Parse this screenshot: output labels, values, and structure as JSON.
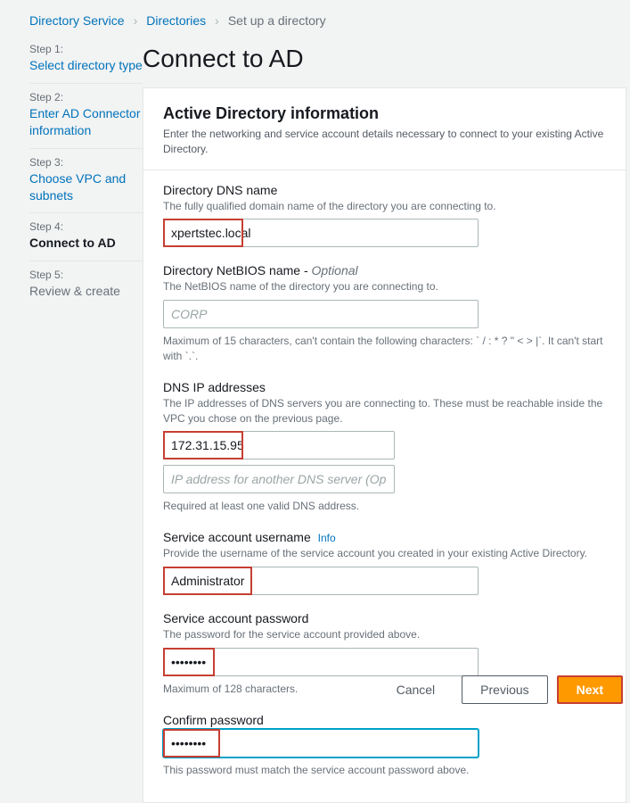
{
  "breadcrumb": {
    "root": "Directory Service",
    "section": "Directories",
    "current": "Set up a directory"
  },
  "sidebar": {
    "steps": [
      {
        "label": "Step 1:",
        "title": "Select directory type"
      },
      {
        "label": "Step 2:",
        "title": "Enter AD Connector information"
      },
      {
        "label": "Step 3:",
        "title": "Choose VPC and subnets"
      },
      {
        "label": "Step 4:",
        "title": "Connect to AD"
      },
      {
        "label": "Step 5:",
        "title": "Review & create"
      }
    ]
  },
  "page": {
    "title": "Connect to AD",
    "panel_header": "Active Directory information",
    "panel_sub": "Enter the networking and service account details necessary to connect to your existing Active Directory."
  },
  "fields": {
    "dns_name": {
      "label": "Directory DNS name",
      "hint": "The fully qualified domain name of the directory you are connecting to.",
      "value": "xpertstec.local"
    },
    "netbios": {
      "label": "Directory NetBIOS name - ",
      "optional": "Optional",
      "hint": "The NetBIOS name of the directory you are connecting to.",
      "placeholder": "CORP",
      "below": "Maximum of 15 characters, can't contain the following characters: ` / : * ? \" < > |`. It can't start with `.`."
    },
    "dns_ips": {
      "label": "DNS IP addresses",
      "hint": "The IP addresses of DNS servers you are connecting to. These must be reachable inside the VPC you chose on the previous page.",
      "value1": "172.31.15.95",
      "placeholder2": "IP address for another DNS server (Optional)",
      "below": "Required at least one valid DNS address."
    },
    "username": {
      "label": "Service account username",
      "info": "Info",
      "hint": "Provide the username of the service account you created in your existing Active Directory.",
      "value": "Administrator"
    },
    "password": {
      "label": "Service account password",
      "hint": "The password for the service account provided above.",
      "value": "••••••••",
      "below": "Maximum of 128 characters."
    },
    "confirm": {
      "label": "Confirm password",
      "value": "••••••••",
      "below": "This password must match the service account password above."
    }
  },
  "footer": {
    "cancel": "Cancel",
    "previous": "Previous",
    "next": "Next"
  }
}
